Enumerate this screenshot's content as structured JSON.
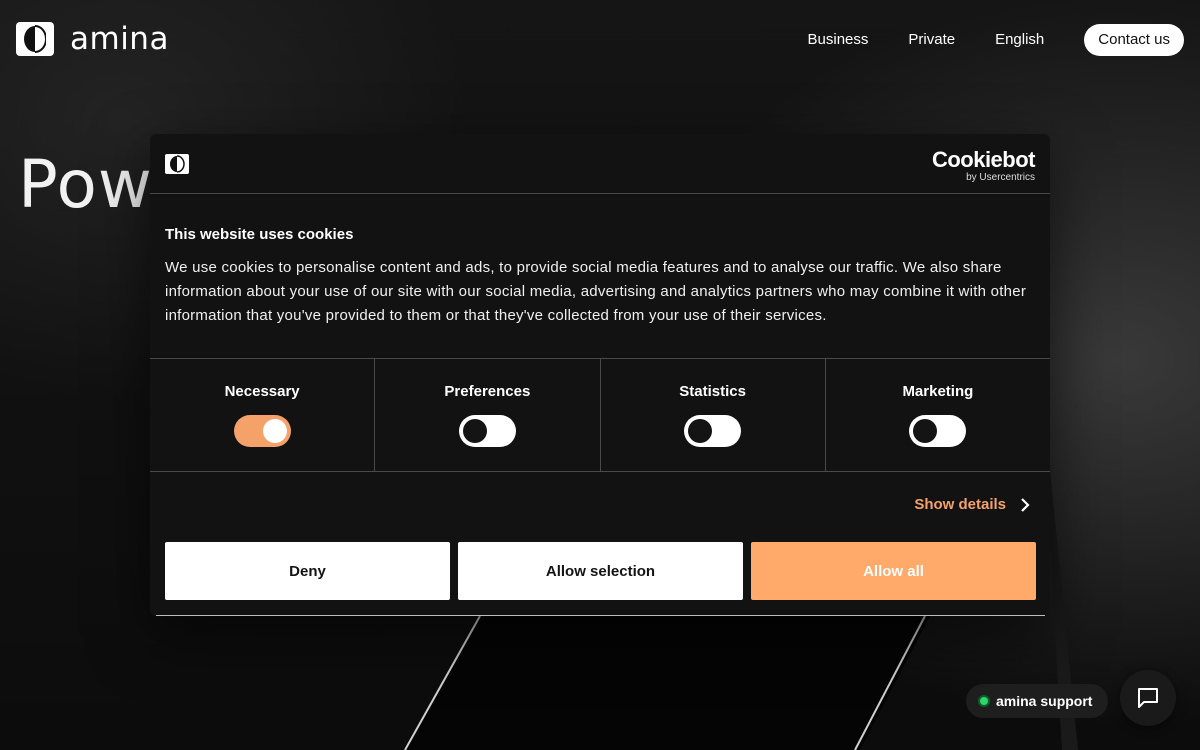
{
  "header": {
    "brand": "amina",
    "nav": [
      "Business",
      "Private",
      "English"
    ],
    "contact_label": "Contact us"
  },
  "hero": {
    "title_visible": "Powe"
  },
  "cookie_dialog": {
    "provider_name": "Cookiebot",
    "provider_sub": "by Usercentrics",
    "heading": "This website uses cookies",
    "text": "We use cookies to personalise content and ads, to provide social media features and to analyse our traffic. We also share information about your use of our site with our social media, advertising and analytics partners who may combine it with other information that you've provided to them or that they've collected from your use of their services.",
    "categories": [
      {
        "label": "Necessary",
        "enabled": true
      },
      {
        "label": "Preferences",
        "enabled": false
      },
      {
        "label": "Statistics",
        "enabled": false
      },
      {
        "label": "Marketing",
        "enabled": false
      }
    ],
    "show_details_label": "Show details",
    "buttons": {
      "deny": "Deny",
      "allow_selection": "Allow selection",
      "allow_all": "Allow all"
    },
    "accent_color": "#ffa96a"
  },
  "support": {
    "label": "amina support",
    "status_color": "#2fd46a"
  }
}
